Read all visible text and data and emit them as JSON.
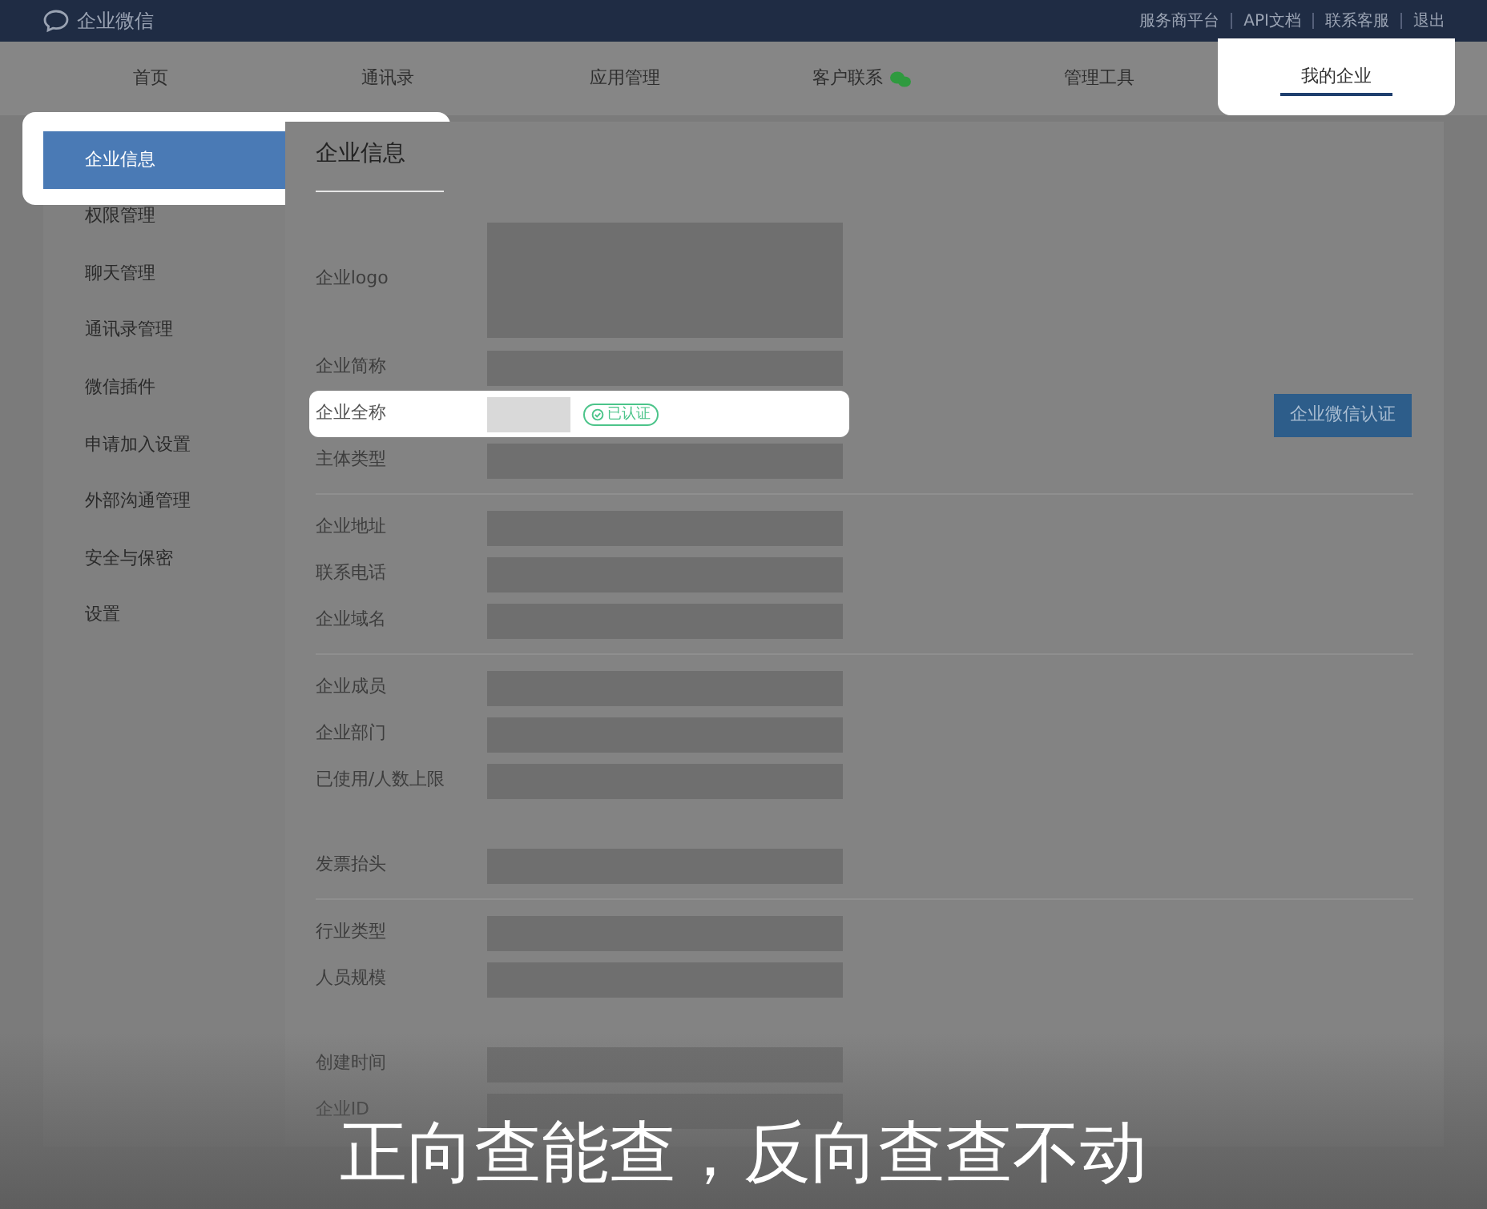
{
  "topbar": {
    "brand": "企业微信",
    "links": [
      "服务商平台",
      "API文档",
      "联系客服",
      "退出"
    ]
  },
  "nav": [
    {
      "label": "首页",
      "selected": false,
      "highlighted": false,
      "badge": false
    },
    {
      "label": "通讯录",
      "selected": false,
      "highlighted": false,
      "badge": false
    },
    {
      "label": "应用管理",
      "selected": false,
      "highlighted": false,
      "badge": false
    },
    {
      "label": "客户联系",
      "selected": false,
      "highlighted": false,
      "badge": true
    },
    {
      "label": "管理工具",
      "selected": false,
      "highlighted": false,
      "badge": false
    },
    {
      "label": "我的企业",
      "selected": true,
      "highlighted": true,
      "badge": false
    }
  ],
  "sidebar": [
    {
      "label": "企业信息",
      "selected": true
    },
    {
      "label": "权限管理",
      "selected": false
    },
    {
      "label": "聊天管理",
      "selected": false
    },
    {
      "label": "通讯录管理",
      "selected": false
    },
    {
      "label": "微信插件",
      "selected": false
    },
    {
      "label": "申请加入设置",
      "selected": false
    },
    {
      "label": "外部沟通管理",
      "selected": false
    },
    {
      "label": "安全与保密",
      "selected": false
    },
    {
      "label": "设置",
      "selected": false
    }
  ],
  "content": {
    "title": "企业信息",
    "verify_button": "企业微信认证",
    "groups": [
      {
        "blocks": [
          [
            {
              "label": "企业logo",
              "kind": "logo",
              "highlighted": false
            },
            {
              "label": "企业简称",
              "kind": "text",
              "highlighted": false
            },
            {
              "label": "企业全称",
              "kind": "verified",
              "badge": "已认证",
              "highlighted": true
            },
            {
              "label": "主体类型",
              "kind": "text",
              "highlighted": false
            }
          ]
        ]
      },
      {
        "blocks": [
          [
            {
              "label": "企业地址",
              "kind": "text",
              "highlighted": false
            },
            {
              "label": "联系电话",
              "kind": "text",
              "highlighted": false
            },
            {
              "label": "企业域名",
              "kind": "text",
              "highlighted": false
            }
          ]
        ]
      },
      {
        "blocks": [
          [
            {
              "label": "企业成员",
              "kind": "text",
              "highlighted": false
            },
            {
              "label": "企业部门",
              "kind": "text",
              "highlighted": false
            },
            {
              "label": "已使用/人数上限",
              "kind": "text",
              "highlighted": false
            }
          ],
          [
            {
              "label": "发票抬头",
              "kind": "text",
              "highlighted": false
            }
          ]
        ]
      },
      {
        "blocks": [
          [
            {
              "label": "行业类型",
              "kind": "text",
              "highlighted": false
            },
            {
              "label": "人员规模",
              "kind": "text",
              "highlighted": false
            }
          ],
          [
            {
              "label": "创建时间",
              "kind": "text",
              "highlighted": false
            },
            {
              "label": "企业ID",
              "kind": "text",
              "highlighted": false
            }
          ]
        ]
      }
    ]
  },
  "caption": "正向查能查，反向查查不动"
}
